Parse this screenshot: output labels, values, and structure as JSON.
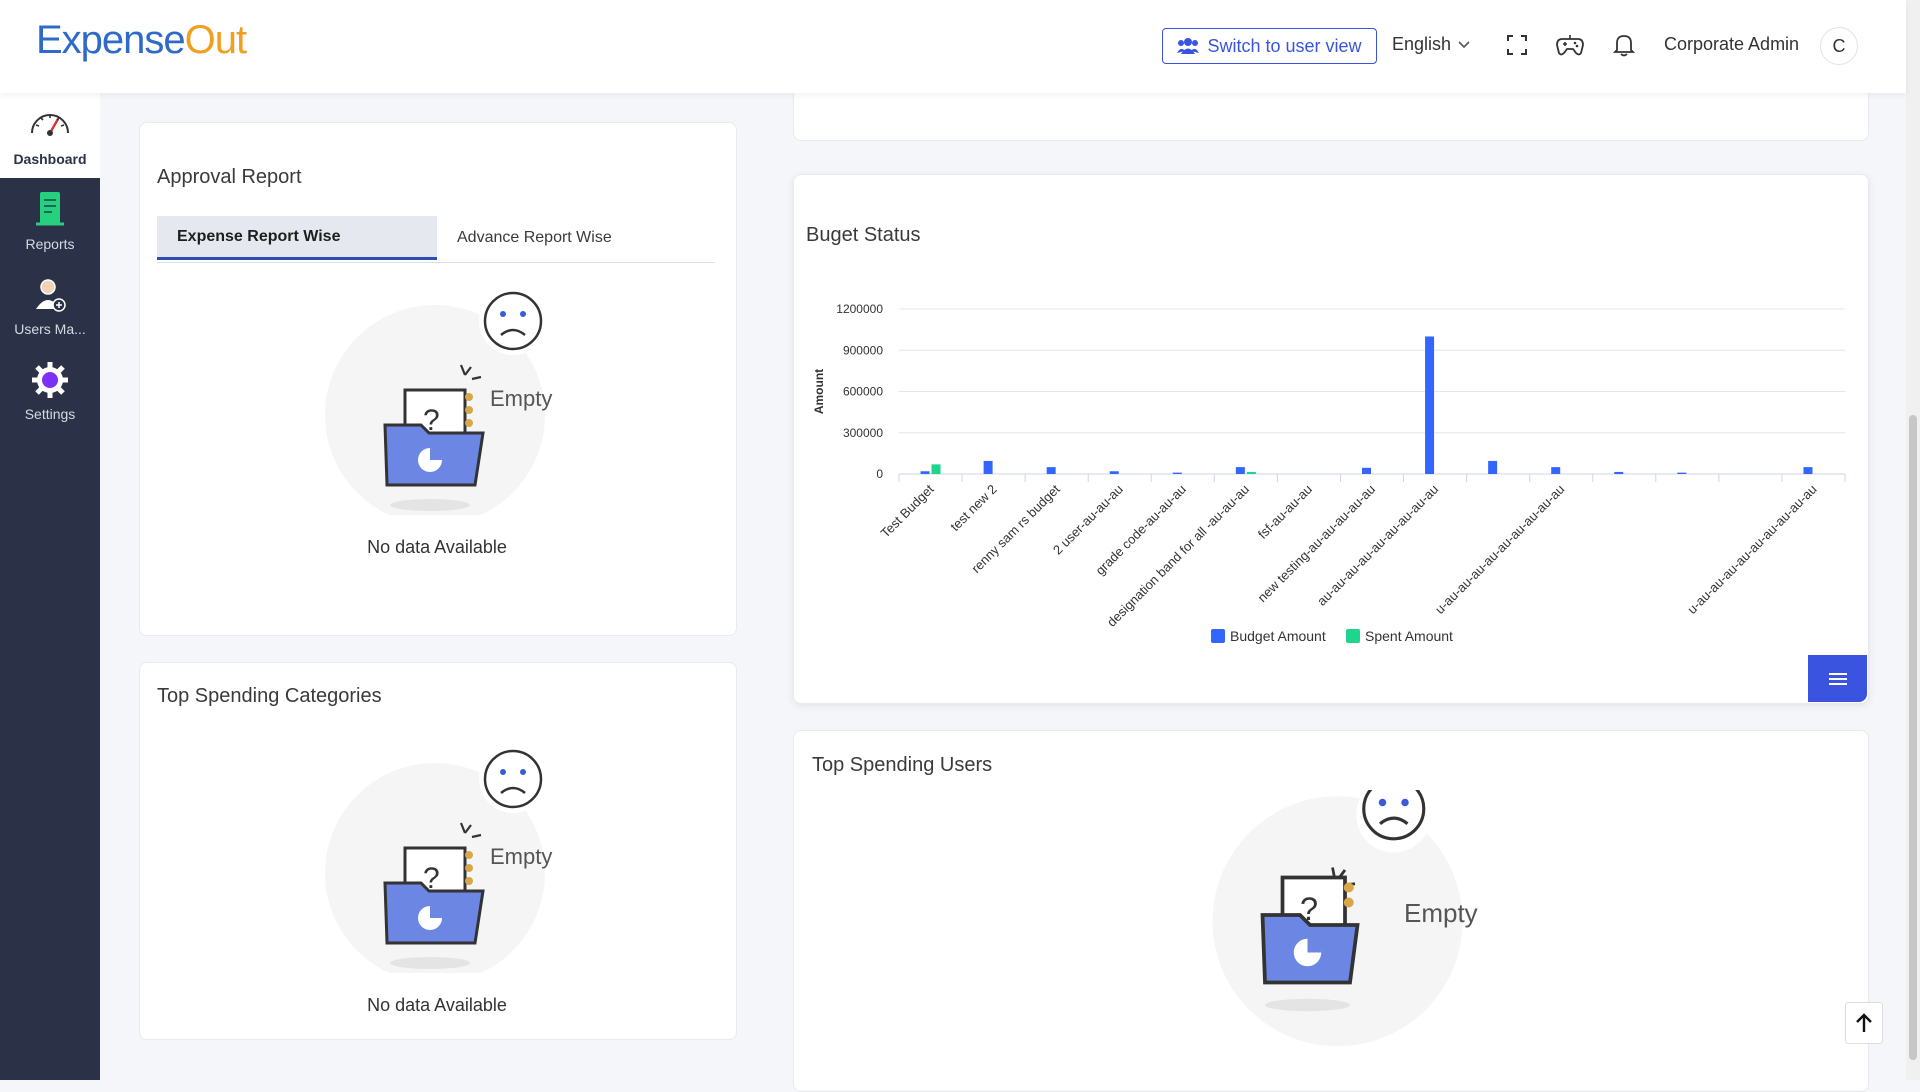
{
  "header": {
    "logo_part1": "Expense",
    "logo_part2": "O",
    "logo_part3": "ut",
    "switch_label": "Switch to user view",
    "language": "English",
    "user_name": "Corporate Admin",
    "avatar_initial": "C",
    "icons": [
      "users-icon",
      "chevron-down-icon",
      "fullscreen-icon",
      "gamepad-icon",
      "bell-icon"
    ]
  },
  "sidebar": {
    "items": [
      {
        "label": "Dashboard",
        "icon": "speedometer-icon"
      },
      {
        "label": "Reports",
        "icon": "report-icon"
      },
      {
        "label": "Users Ma...",
        "icon": "user-add-icon"
      },
      {
        "label": "Settings",
        "icon": "gear-icon"
      }
    ]
  },
  "approval": {
    "title": "Approval Report",
    "tabs": [
      "Expense Report Wise",
      "Advance Report Wise"
    ],
    "empty_text": "Empty",
    "no_data": "No data Available"
  },
  "categories": {
    "title": "Top Spending Categories",
    "empty_text": "Empty",
    "no_data": "No data Available"
  },
  "users": {
    "title": "Top Spending Users",
    "empty_text": "Empty"
  },
  "budget": {
    "title": "Buget Status"
  },
  "chart_data": {
    "type": "bar",
    "title": "Buget Status",
    "ylabel": "Amount",
    "xlabel": "",
    "ylim": [
      0,
      1200000
    ],
    "yticks": [
      0,
      300000,
      600000,
      900000,
      1200000
    ],
    "grid": true,
    "legend": "bottom",
    "categories": [
      "Test Budget",
      "test new 2",
      "renny sam rs budget",
      "2 user-au-au-au",
      "grade code-au-au-au",
      "designation band for all -au-au-au",
      "fsf-au-au-au",
      "new testing-au-au-au-au-au",
      "au-au-au-au-au-au-au-au-au",
      "",
      "u-au-au-au-au-au-au-au-au-au",
      "",
      "",
      "",
      "u-au-au-au-au-au-au-au-au-au"
    ],
    "series": [
      {
        "name": "Budget Amount",
        "color": "#3366ff",
        "values": [
          20000,
          95000,
          50000,
          20000,
          10000,
          50000,
          0,
          45000,
          1000000,
          95000,
          50000,
          15000,
          10000,
          0,
          50000
        ]
      },
      {
        "name": "Spent Amount",
        "color": "#1dd58c",
        "values": [
          70000,
          0,
          0,
          0,
          0,
          15000,
          0,
          0,
          0,
          0,
          0,
          0,
          0,
          0,
          0
        ]
      }
    ]
  }
}
